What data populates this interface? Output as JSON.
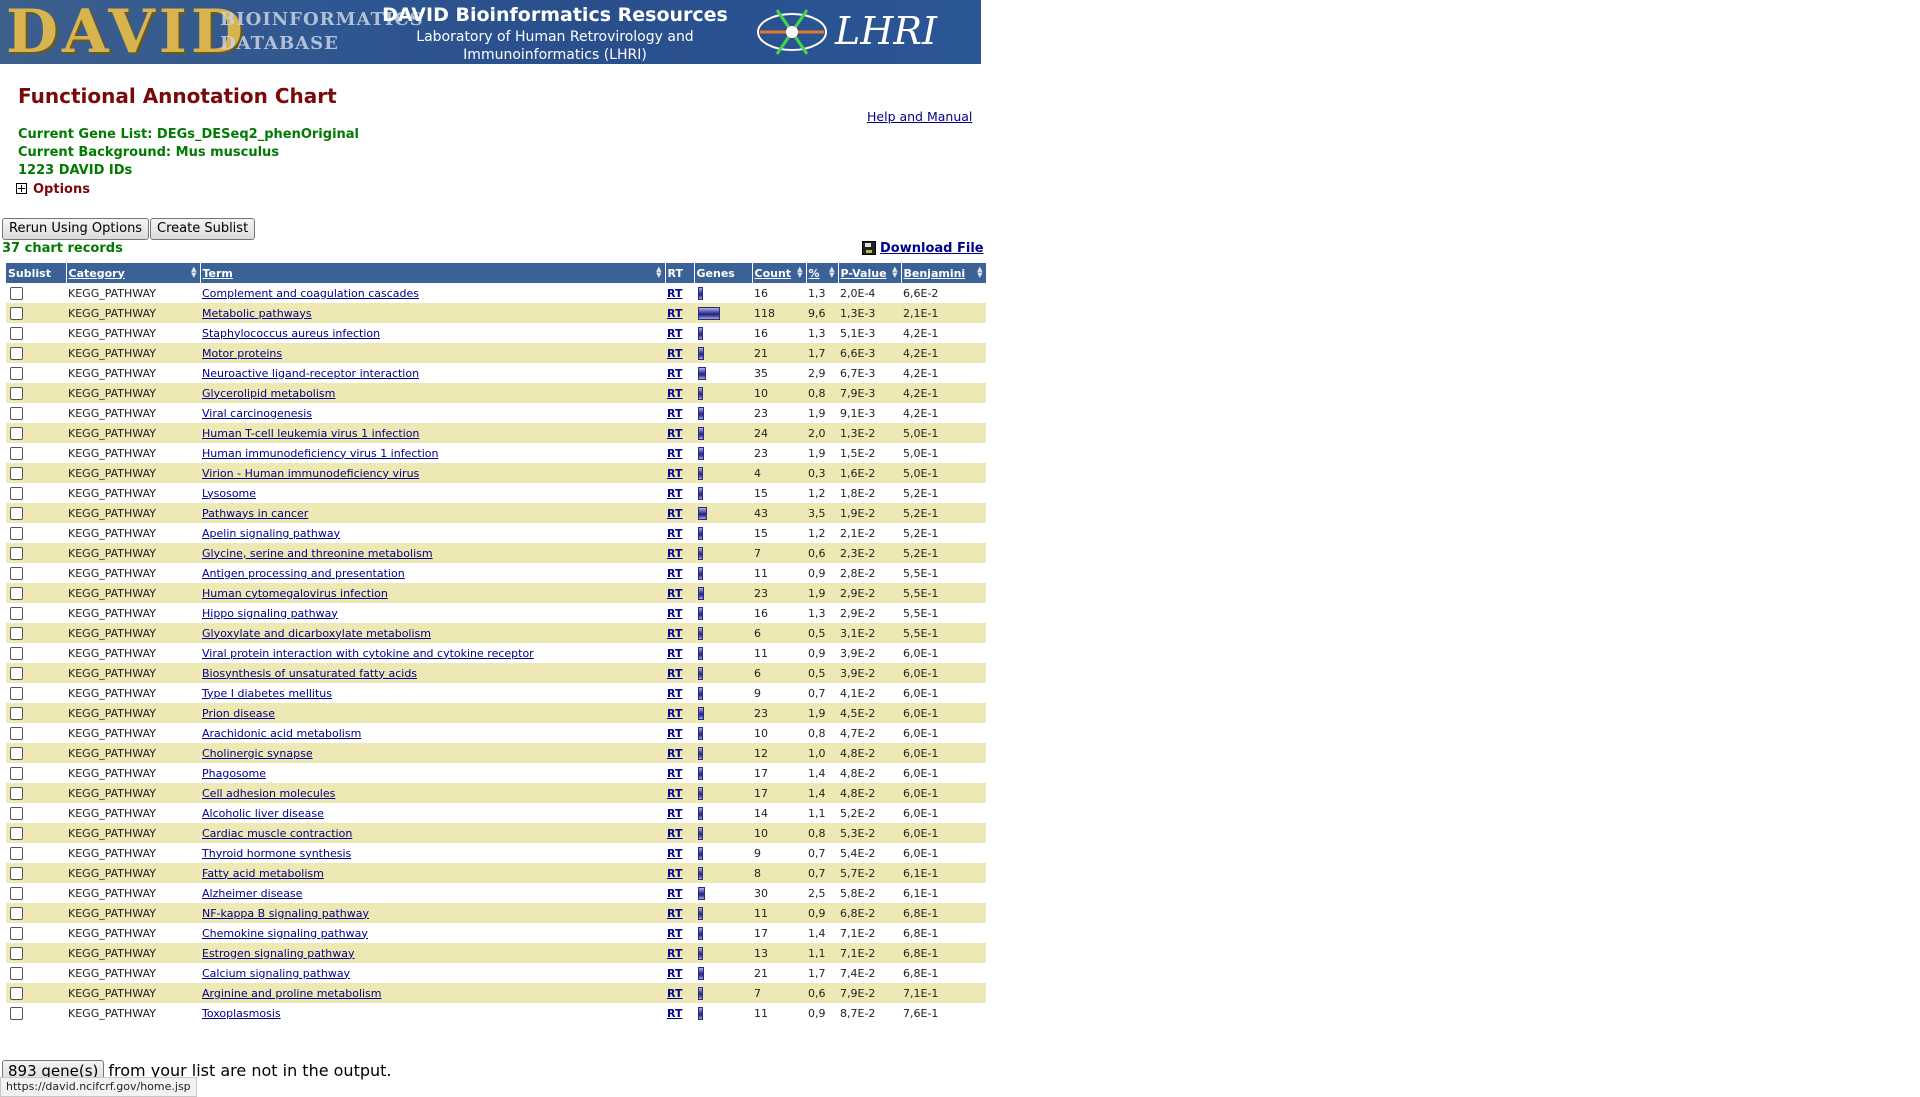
{
  "banner": {
    "logo_text": "DAVID",
    "logo_sub1": "BIOINFORMATICS",
    "logo_sub2": "DATABASE",
    "title": "DAVID Bioinformatics Resources",
    "subtitle_line1": "Laboratory of Human Retrovirology and",
    "subtitle_line2": "Immunoinformatics (LHRI)",
    "lhri": "LHRI"
  },
  "page": {
    "title": "Functional Annotation Chart",
    "help_link": "Help and Manual",
    "gene_list": "Current Gene List: DEGs_DESeq2_phenOriginal",
    "background": "Current Background: Mus musculus",
    "david_ids": "1223 DAVID IDs",
    "options_label": "Options"
  },
  "buttons": {
    "rerun": "Rerun Using Options",
    "sublist": "Create Sublist"
  },
  "chart_records": "37 chart records",
  "download": "Download File",
  "table": {
    "headers": {
      "sublist": "Sublist",
      "category": "Category",
      "term": "Term",
      "rt": "RT",
      "genes": "Genes",
      "count": "Count",
      "percent": "%",
      "pvalue": "P-Value",
      "benjamini": "Benjamini"
    },
    "rows": [
      {
        "category": "KEGG_PATHWAY",
        "term": "Complement and coagulation cascades",
        "rt": "RT",
        "count": "16",
        "percent": "1,3",
        "pvalue": "2,0E-4",
        "benjamini": "6,6E-2"
      },
      {
        "category": "KEGG_PATHWAY",
        "term": "Metabolic pathways",
        "rt": "RT",
        "count": "118",
        "percent": "9,6",
        "pvalue": "1,3E-3",
        "benjamini": "2,1E-1"
      },
      {
        "category": "KEGG_PATHWAY",
        "term": "Staphylococcus aureus infection",
        "rt": "RT",
        "count": "16",
        "percent": "1,3",
        "pvalue": "5,1E-3",
        "benjamini": "4,2E-1"
      },
      {
        "category": "KEGG_PATHWAY",
        "term": "Motor proteins",
        "rt": "RT",
        "count": "21",
        "percent": "1,7",
        "pvalue": "6,6E-3",
        "benjamini": "4,2E-1"
      },
      {
        "category": "KEGG_PATHWAY",
        "term": "Neuroactive ligand-receptor interaction",
        "rt": "RT",
        "count": "35",
        "percent": "2,9",
        "pvalue": "6,7E-3",
        "benjamini": "4,2E-1"
      },
      {
        "category": "KEGG_PATHWAY",
        "term": "Glycerolipid metabolism",
        "rt": "RT",
        "count": "10",
        "percent": "0,8",
        "pvalue": "7,9E-3",
        "benjamini": "4,2E-1"
      },
      {
        "category": "KEGG_PATHWAY",
        "term": "Viral carcinogenesis",
        "rt": "RT",
        "count": "23",
        "percent": "1,9",
        "pvalue": "9,1E-3",
        "benjamini": "4,2E-1"
      },
      {
        "category": "KEGG_PATHWAY",
        "term": "Human T-cell leukemia virus 1 infection",
        "rt": "RT",
        "count": "24",
        "percent": "2,0",
        "pvalue": "1,3E-2",
        "benjamini": "5,0E-1"
      },
      {
        "category": "KEGG_PATHWAY",
        "term": "Human immunodeficiency virus 1 infection",
        "rt": "RT",
        "count": "23",
        "percent": "1,9",
        "pvalue": "1,5E-2",
        "benjamini": "5,0E-1"
      },
      {
        "category": "KEGG_PATHWAY",
        "term": "Virion - Human immunodeficiency virus",
        "rt": "RT",
        "count": "4",
        "percent": "0,3",
        "pvalue": "1,6E-2",
        "benjamini": "5,0E-1"
      },
      {
        "category": "KEGG_PATHWAY",
        "term": "Lysosome",
        "rt": "RT",
        "count": "15",
        "percent": "1,2",
        "pvalue": "1,8E-2",
        "benjamini": "5,2E-1"
      },
      {
        "category": "KEGG_PATHWAY",
        "term": "Pathways in cancer",
        "rt": "RT",
        "count": "43",
        "percent": "3,5",
        "pvalue": "1,9E-2",
        "benjamini": "5,2E-1"
      },
      {
        "category": "KEGG_PATHWAY",
        "term": "Apelin signaling pathway",
        "rt": "RT",
        "count": "15",
        "percent": "1,2",
        "pvalue": "2,1E-2",
        "benjamini": "5,2E-1"
      },
      {
        "category": "KEGG_PATHWAY",
        "term": "Glycine, serine and threonine metabolism",
        "rt": "RT",
        "count": "7",
        "percent": "0,6",
        "pvalue": "2,3E-2",
        "benjamini": "5,2E-1"
      },
      {
        "category": "KEGG_PATHWAY",
        "term": "Antigen processing and presentation",
        "rt": "RT",
        "count": "11",
        "percent": "0,9",
        "pvalue": "2,8E-2",
        "benjamini": "5,5E-1"
      },
      {
        "category": "KEGG_PATHWAY",
        "term": "Human cytomegalovirus infection",
        "rt": "RT",
        "count": "23",
        "percent": "1,9",
        "pvalue": "2,9E-2",
        "benjamini": "5,5E-1"
      },
      {
        "category": "KEGG_PATHWAY",
        "term": "Hippo signaling pathway",
        "rt": "RT",
        "count": "16",
        "percent": "1,3",
        "pvalue": "2,9E-2",
        "benjamini": "5,5E-1"
      },
      {
        "category": "KEGG_PATHWAY",
        "term": "Glyoxylate and dicarboxylate metabolism",
        "rt": "RT",
        "count": "6",
        "percent": "0,5",
        "pvalue": "3,1E-2",
        "benjamini": "5,5E-1"
      },
      {
        "category": "KEGG_PATHWAY",
        "term": "Viral protein interaction with cytokine and cytokine receptor",
        "rt": "RT",
        "count": "11",
        "percent": "0,9",
        "pvalue": "3,9E-2",
        "benjamini": "6,0E-1"
      },
      {
        "category": "KEGG_PATHWAY",
        "term": "Biosynthesis of unsaturated fatty acids",
        "rt": "RT",
        "count": "6",
        "percent": "0,5",
        "pvalue": "3,9E-2",
        "benjamini": "6,0E-1"
      },
      {
        "category": "KEGG_PATHWAY",
        "term": "Type I diabetes mellitus",
        "rt": "RT",
        "count": "9",
        "percent": "0,7",
        "pvalue": "4,1E-2",
        "benjamini": "6,0E-1"
      },
      {
        "category": "KEGG_PATHWAY",
        "term": "Prion disease",
        "rt": "RT",
        "count": "23",
        "percent": "1,9",
        "pvalue": "4,5E-2",
        "benjamini": "6,0E-1"
      },
      {
        "category": "KEGG_PATHWAY",
        "term": "Arachidonic acid metabolism",
        "rt": "RT",
        "count": "10",
        "percent": "0,8",
        "pvalue": "4,7E-2",
        "benjamini": "6,0E-1"
      },
      {
        "category": "KEGG_PATHWAY",
        "term": "Cholinergic synapse",
        "rt": "RT",
        "count": "12",
        "percent": "1,0",
        "pvalue": "4,8E-2",
        "benjamini": "6,0E-1"
      },
      {
        "category": "KEGG_PATHWAY",
        "term": "Phagosome",
        "rt": "RT",
        "count": "17",
        "percent": "1,4",
        "pvalue": "4,8E-2",
        "benjamini": "6,0E-1"
      },
      {
        "category": "KEGG_PATHWAY",
        "term": "Cell adhesion molecules",
        "rt": "RT",
        "count": "17",
        "percent": "1,4",
        "pvalue": "4,8E-2",
        "benjamini": "6,0E-1"
      },
      {
        "category": "KEGG_PATHWAY",
        "term": "Alcoholic liver disease",
        "rt": "RT",
        "count": "14",
        "percent": "1,1",
        "pvalue": "5,2E-2",
        "benjamini": "6,0E-1"
      },
      {
        "category": "KEGG_PATHWAY",
        "term": "Cardiac muscle contraction",
        "rt": "RT",
        "count": "10",
        "percent": "0,8",
        "pvalue": "5,3E-2",
        "benjamini": "6,0E-1"
      },
      {
        "category": "KEGG_PATHWAY",
        "term": "Thyroid hormone synthesis",
        "rt": "RT",
        "count": "9",
        "percent": "0,7",
        "pvalue": "5,4E-2",
        "benjamini": "6,0E-1"
      },
      {
        "category": "KEGG_PATHWAY",
        "term": "Fatty acid metabolism",
        "rt": "RT",
        "count": "8",
        "percent": "0,7",
        "pvalue": "5,7E-2",
        "benjamini": "6,1E-1"
      },
      {
        "category": "KEGG_PATHWAY",
        "term": "Alzheimer disease",
        "rt": "RT",
        "count": "30",
        "percent": "2,5",
        "pvalue": "5,8E-2",
        "benjamini": "6,1E-1"
      },
      {
        "category": "KEGG_PATHWAY",
        "term": "NF-kappa B signaling pathway",
        "rt": "RT",
        "count": "11",
        "percent": "0,9",
        "pvalue": "6,8E-2",
        "benjamini": "6,8E-1"
      },
      {
        "category": "KEGG_PATHWAY",
        "term": "Chemokine signaling pathway",
        "rt": "RT",
        "count": "17",
        "percent": "1,4",
        "pvalue": "7,1E-2",
        "benjamini": "6,8E-1"
      },
      {
        "category": "KEGG_PATHWAY",
        "term": "Estrogen signaling pathway",
        "rt": "RT",
        "count": "13",
        "percent": "1,1",
        "pvalue": "7,1E-2",
        "benjamini": "6,8E-1"
      },
      {
        "category": "KEGG_PATHWAY",
        "term": "Calcium signaling pathway",
        "rt": "RT",
        "count": "21",
        "percent": "1,7",
        "pvalue": "7,4E-2",
        "benjamini": "6,8E-1"
      },
      {
        "category": "KEGG_PATHWAY",
        "term": "Arginine and proline metabolism",
        "rt": "RT",
        "count": "7",
        "percent": "0,6",
        "pvalue": "7,9E-2",
        "benjamini": "7,1E-1"
      },
      {
        "category": "KEGG_PATHWAY",
        "term": "Toxoplasmosis",
        "rt": "RT",
        "count": "11",
        "percent": "0,9",
        "pvalue": "8,7E-2",
        "benjamini": "7,6E-1"
      }
    ]
  },
  "footer": {
    "genes_button": "893 gene(s)",
    "genes_text": "from your list are not in the output."
  },
  "status_url": "https://david.ncifcrf.gov/home.jsp"
}
